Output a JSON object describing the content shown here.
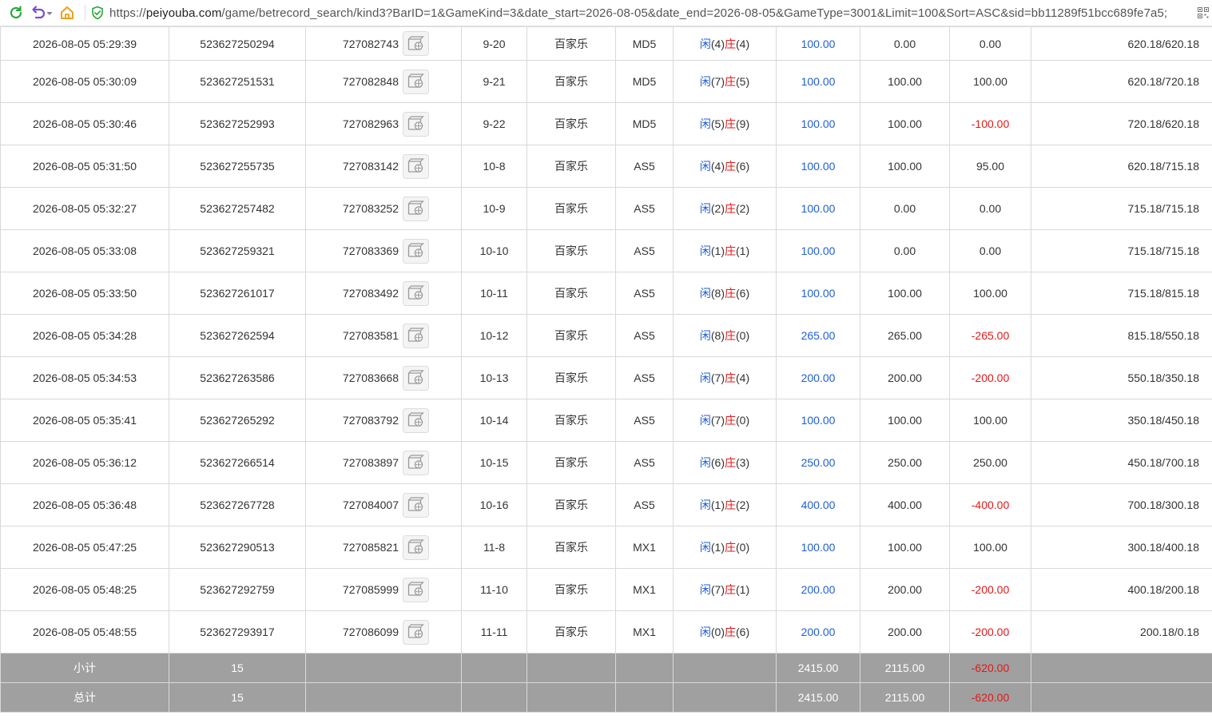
{
  "browser": {
    "url_scheme": "https://",
    "url_host": "peiyouba.com",
    "url_path": "/game/betrecord_search/kind3?BarID=1&GameKind=3&date_start=2026-08-05&date_end=2026-08-05&GameType=3001&Limit=100&Sort=ASC&sid=bb11289f51bcc689fe7a5;"
  },
  "labels": {
    "xian": "闲",
    "zhuang": "庄"
  },
  "rows": [
    {
      "time": "2026-08-05 05:29:39",
      "bet_id": "523627250294",
      "round_id": "727082743",
      "shoe": "9-20",
      "game": "百家乐",
      "table": "MD5",
      "player": "4",
      "banker": "4",
      "bet": "100.00",
      "valid": "0.00",
      "win": "0.00",
      "win_neg": false,
      "balance": "620.18/620.18"
    },
    {
      "time": "2026-08-05 05:30:09",
      "bet_id": "523627251531",
      "round_id": "727082848",
      "shoe": "9-21",
      "game": "百家乐",
      "table": "MD5",
      "player": "7",
      "banker": "5",
      "bet": "100.00",
      "valid": "100.00",
      "win": "100.00",
      "win_neg": false,
      "balance": "620.18/720.18"
    },
    {
      "time": "2026-08-05 05:30:46",
      "bet_id": "523627252993",
      "round_id": "727082963",
      "shoe": "9-22",
      "game": "百家乐",
      "table": "MD5",
      "player": "5",
      "banker": "9",
      "bet": "100.00",
      "valid": "100.00",
      "win": "-100.00",
      "win_neg": true,
      "balance": "720.18/620.18"
    },
    {
      "time": "2026-08-05 05:31:50",
      "bet_id": "523627255735",
      "round_id": "727083142",
      "shoe": "10-8",
      "game": "百家乐",
      "table": "AS5",
      "player": "4",
      "banker": "6",
      "bet": "100.00",
      "valid": "100.00",
      "win": "95.00",
      "win_neg": false,
      "balance": "620.18/715.18"
    },
    {
      "time": "2026-08-05 05:32:27",
      "bet_id": "523627257482",
      "round_id": "727083252",
      "shoe": "10-9",
      "game": "百家乐",
      "table": "AS5",
      "player": "2",
      "banker": "2",
      "bet": "100.00",
      "valid": "0.00",
      "win": "0.00",
      "win_neg": false,
      "balance": "715.18/715.18"
    },
    {
      "time": "2026-08-05 05:33:08",
      "bet_id": "523627259321",
      "round_id": "727083369",
      "shoe": "10-10",
      "game": "百家乐",
      "table": "AS5",
      "player": "1",
      "banker": "1",
      "bet": "100.00",
      "valid": "0.00",
      "win": "0.00",
      "win_neg": false,
      "balance": "715.18/715.18"
    },
    {
      "time": "2026-08-05 05:33:50",
      "bet_id": "523627261017",
      "round_id": "727083492",
      "shoe": "10-11",
      "game": "百家乐",
      "table": "AS5",
      "player": "8",
      "banker": "6",
      "bet": "100.00",
      "valid": "100.00",
      "win": "100.00",
      "win_neg": false,
      "balance": "715.18/815.18"
    },
    {
      "time": "2026-08-05 05:34:28",
      "bet_id": "523627262594",
      "round_id": "727083581",
      "shoe": "10-12",
      "game": "百家乐",
      "table": "AS5",
      "player": "8",
      "banker": "0",
      "bet": "265.00",
      "valid": "265.00",
      "win": "-265.00",
      "win_neg": true,
      "balance": "815.18/550.18"
    },
    {
      "time": "2026-08-05 05:34:53",
      "bet_id": "523627263586",
      "round_id": "727083668",
      "shoe": "10-13",
      "game": "百家乐",
      "table": "AS5",
      "player": "7",
      "banker": "4",
      "bet": "200.00",
      "valid": "200.00",
      "win": "-200.00",
      "win_neg": true,
      "balance": "550.18/350.18"
    },
    {
      "time": "2026-08-05 05:35:41",
      "bet_id": "523627265292",
      "round_id": "727083792",
      "shoe": "10-14",
      "game": "百家乐",
      "table": "AS5",
      "player": "7",
      "banker": "0",
      "bet": "100.00",
      "valid": "100.00",
      "win": "100.00",
      "win_neg": false,
      "balance": "350.18/450.18"
    },
    {
      "time": "2026-08-05 05:36:12",
      "bet_id": "523627266514",
      "round_id": "727083897",
      "shoe": "10-15",
      "game": "百家乐",
      "table": "AS5",
      "player": "6",
      "banker": "3",
      "bet": "250.00",
      "valid": "250.00",
      "win": "250.00",
      "win_neg": false,
      "balance": "450.18/700.18"
    },
    {
      "time": "2026-08-05 05:36:48",
      "bet_id": "523627267728",
      "round_id": "727084007",
      "shoe": "10-16",
      "game": "百家乐",
      "table": "AS5",
      "player": "1",
      "banker": "2",
      "bet": "400.00",
      "valid": "400.00",
      "win": "-400.00",
      "win_neg": true,
      "balance": "700.18/300.18"
    },
    {
      "time": "2026-08-05 05:47:25",
      "bet_id": "523627290513",
      "round_id": "727085821",
      "shoe": "11-8",
      "game": "百家乐",
      "table": "MX1",
      "player": "1",
      "banker": "0",
      "bet": "100.00",
      "valid": "100.00",
      "win": "100.00",
      "win_neg": false,
      "balance": "300.18/400.18"
    },
    {
      "time": "2026-08-05 05:48:25",
      "bet_id": "523627292759",
      "round_id": "727085999",
      "shoe": "11-10",
      "game": "百家乐",
      "table": "MX1",
      "player": "7",
      "banker": "1",
      "bet": "200.00",
      "valid": "200.00",
      "win": "-200.00",
      "win_neg": true,
      "balance": "400.18/200.18"
    },
    {
      "time": "2026-08-05 05:48:55",
      "bet_id": "523627293917",
      "round_id": "727086099",
      "shoe": "11-11",
      "game": "百家乐",
      "table": "MX1",
      "player": "0",
      "banker": "6",
      "bet": "200.00",
      "valid": "200.00",
      "win": "-200.00",
      "win_neg": true,
      "balance": "200.18/0.18"
    }
  ],
  "subtotal": {
    "label": "小计",
    "count": "15",
    "bet": "2415.00",
    "valid": "2115.00",
    "win": "-620.00"
  },
  "total": {
    "label": "总计",
    "count": "15",
    "bet": "2415.00",
    "valid": "2115.00",
    "win": "-620.00"
  }
}
